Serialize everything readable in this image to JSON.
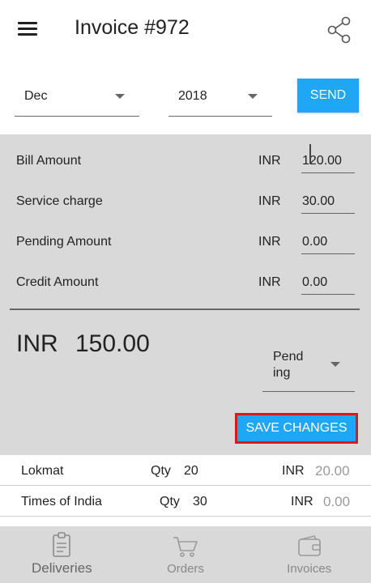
{
  "header": {
    "title": "Invoice #972",
    "menu_icon": "hamburger-menu-icon",
    "share_icon": "share-icon"
  },
  "filters": {
    "month": "Dec",
    "year": "2018",
    "send_label": "SEND"
  },
  "amounts": [
    {
      "label": "Bill Amount",
      "currency": "INR",
      "value": "120.00"
    },
    {
      "label": "Service charge",
      "currency": "INR",
      "value": "30.00"
    },
    {
      "label": "Pending Amount",
      "currency": "INR",
      "value": "0.00"
    },
    {
      "label": "Credit Amount",
      "currency": "INR",
      "value": "0.00"
    }
  ],
  "total": {
    "currency": "INR",
    "value": "150.00"
  },
  "status": {
    "selected": "Pending"
  },
  "save_label": "SAVE CHANGES",
  "items": [
    {
      "name": "Lokmat",
      "qty_label": "Qty",
      "qty": "20",
      "currency": "INR",
      "price": "20.00"
    },
    {
      "name": "Times of India",
      "qty_label": "Qty",
      "qty": "30",
      "currency": "INR",
      "price": "0.00"
    }
  ],
  "nav": [
    {
      "label": "Deliveries",
      "icon": "clipboard-icon",
      "active": true
    },
    {
      "label": "Orders",
      "icon": "shopping-cart-icon",
      "active": false
    },
    {
      "label": "Invoices",
      "icon": "wallet-icon",
      "active": false
    }
  ],
  "colors": {
    "accent": "#1ea7f5",
    "highlight_border": "#d71920",
    "panel": "#d9d9d9"
  }
}
